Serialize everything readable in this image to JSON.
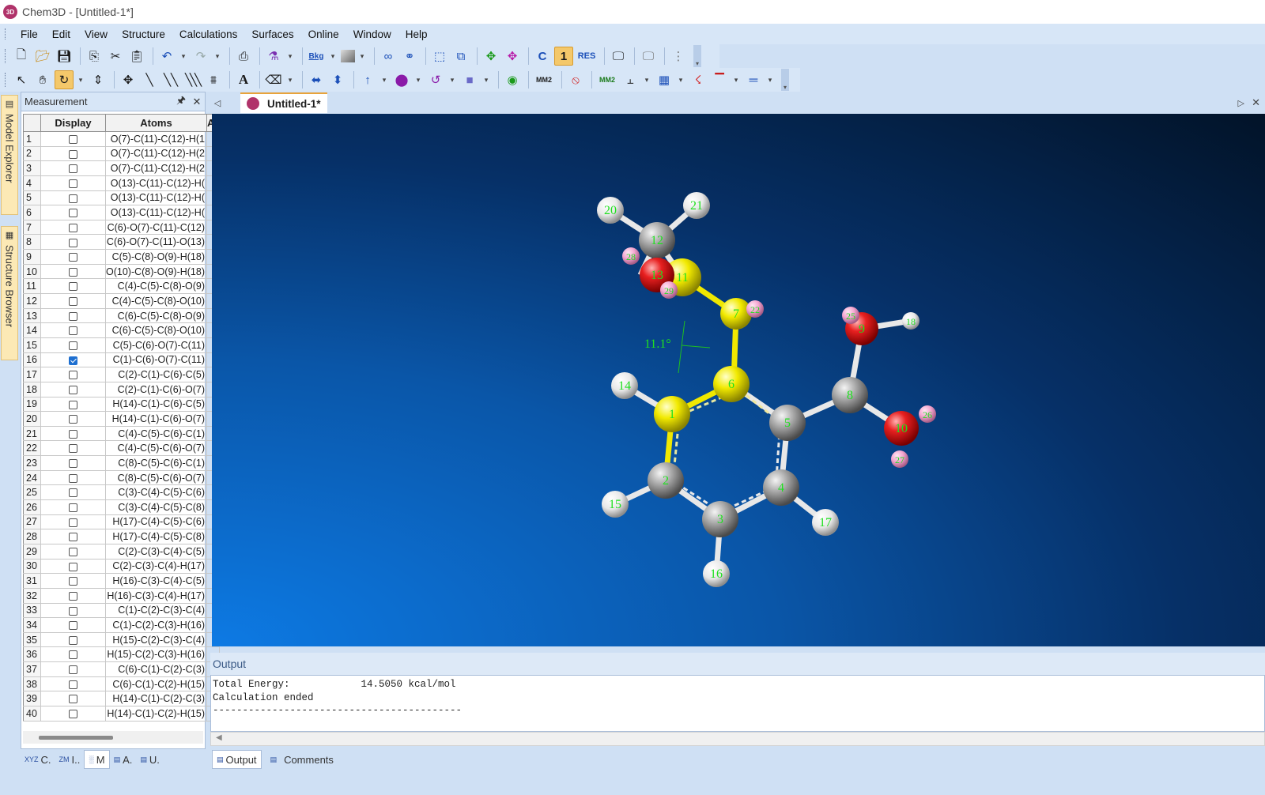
{
  "app": {
    "title": "Chem3D - [Untitled-1*]",
    "icon_label": "3D"
  },
  "menu": [
    "File",
    "Edit",
    "View",
    "Structure",
    "Calculations",
    "Surfaces",
    "Online",
    "Window",
    "Help"
  ],
  "toolbar1": {
    "bkg_label": "Bkg",
    "c_label": "C",
    "one_label": "1",
    "res_label": "RES"
  },
  "toolbar2": {
    "text_tool_label": "A",
    "mm2_label": "MM2",
    "mm2_run_label": "MM2"
  },
  "side_tabs": {
    "model_explorer": "Model Explorer",
    "structure_browser": "Structure Browser"
  },
  "measurement": {
    "title": "Measurement",
    "columns": [
      "",
      "Display",
      "Atoms",
      "Ac"
    ],
    "rows": [
      {
        "n": "1",
        "checked": false,
        "atoms": "O(7)-C(11)-C(12)-H(1"
      },
      {
        "n": "2",
        "checked": false,
        "atoms": "O(7)-C(11)-C(12)-H(2"
      },
      {
        "n": "3",
        "checked": false,
        "atoms": "O(7)-C(11)-C(12)-H(2"
      },
      {
        "n": "4",
        "checked": false,
        "atoms": "O(13)-C(11)-C(12)-H("
      },
      {
        "n": "5",
        "checked": false,
        "atoms": "O(13)-C(11)-C(12)-H("
      },
      {
        "n": "6",
        "checked": false,
        "atoms": "O(13)-C(11)-C(12)-H("
      },
      {
        "n": "7",
        "checked": false,
        "atoms": "C(6)-O(7)-C(11)-C(12)"
      },
      {
        "n": "8",
        "checked": false,
        "atoms": "C(6)-O(7)-C(11)-O(13)"
      },
      {
        "n": "9",
        "checked": false,
        "atoms": "C(5)-C(8)-O(9)-H(18)"
      },
      {
        "n": "10",
        "checked": false,
        "atoms": "O(10)-C(8)-O(9)-H(18)"
      },
      {
        "n": "11",
        "checked": false,
        "atoms": "C(4)-C(5)-C(8)-O(9)"
      },
      {
        "n": "12",
        "checked": false,
        "atoms": "C(4)-C(5)-C(8)-O(10)"
      },
      {
        "n": "13",
        "checked": false,
        "atoms": "C(6)-C(5)-C(8)-O(9)"
      },
      {
        "n": "14",
        "checked": false,
        "atoms": "C(6)-C(5)-C(8)-O(10)"
      },
      {
        "n": "15",
        "checked": false,
        "atoms": "C(5)-C(6)-O(7)-C(11)"
      },
      {
        "n": "16",
        "checked": true,
        "atoms": "C(1)-C(6)-O(7)-C(11)"
      },
      {
        "n": "17",
        "checked": false,
        "atoms": "C(2)-C(1)-C(6)-C(5)"
      },
      {
        "n": "18",
        "checked": false,
        "atoms": "C(2)-C(1)-C(6)-O(7)"
      },
      {
        "n": "19",
        "checked": false,
        "atoms": "H(14)-C(1)-C(6)-C(5)"
      },
      {
        "n": "20",
        "checked": false,
        "atoms": "H(14)-C(1)-C(6)-O(7)"
      },
      {
        "n": "21",
        "checked": false,
        "atoms": "C(4)-C(5)-C(6)-C(1)"
      },
      {
        "n": "22",
        "checked": false,
        "atoms": "C(4)-C(5)-C(6)-O(7)"
      },
      {
        "n": "23",
        "checked": false,
        "atoms": "C(8)-C(5)-C(6)-C(1)"
      },
      {
        "n": "24",
        "checked": false,
        "atoms": "C(8)-C(5)-C(6)-O(7)"
      },
      {
        "n": "25",
        "checked": false,
        "atoms": "C(3)-C(4)-C(5)-C(6)"
      },
      {
        "n": "26",
        "checked": false,
        "atoms": "C(3)-C(4)-C(5)-C(8)"
      },
      {
        "n": "27",
        "checked": false,
        "atoms": "H(17)-C(4)-C(5)-C(6)"
      },
      {
        "n": "28",
        "checked": false,
        "atoms": "H(17)-C(4)-C(5)-C(8)"
      },
      {
        "n": "29",
        "checked": false,
        "atoms": "C(2)-C(3)-C(4)-C(5)"
      },
      {
        "n": "30",
        "checked": false,
        "atoms": "C(2)-C(3)-C(4)-H(17)"
      },
      {
        "n": "31",
        "checked": false,
        "atoms": "H(16)-C(3)-C(4)-C(5)"
      },
      {
        "n": "32",
        "checked": false,
        "atoms": "H(16)-C(3)-C(4)-H(17)"
      },
      {
        "n": "33",
        "checked": false,
        "atoms": "C(1)-C(2)-C(3)-C(4)"
      },
      {
        "n": "34",
        "checked": false,
        "atoms": "C(1)-C(2)-C(3)-H(16)"
      },
      {
        "n": "35",
        "checked": false,
        "atoms": "H(15)-C(2)-C(3)-C(4)"
      },
      {
        "n": "36",
        "checked": false,
        "atoms": "H(15)-C(2)-C(3)-H(16)"
      },
      {
        "n": "37",
        "checked": false,
        "atoms": "C(6)-C(1)-C(2)-C(3)"
      },
      {
        "n": "38",
        "checked": false,
        "atoms": "C(6)-C(1)-C(2)-H(15)"
      },
      {
        "n": "39",
        "checked": false,
        "atoms": "H(14)-C(1)-C(2)-C(3)"
      },
      {
        "n": "40",
        "checked": false,
        "atoms": "H(14)-C(1)-C(2)-H(15)"
      }
    ]
  },
  "left_bottom_tabs": [
    {
      "icon": "XYZ",
      "label": "C."
    },
    {
      "icon": "ZM",
      "label": "I.."
    },
    {
      "icon": "░",
      "label": "M"
    },
    {
      "icon": "▤",
      "label": "A."
    },
    {
      "icon": "▤",
      "label": "U."
    }
  ],
  "document": {
    "tab_label": "Untitled-1*"
  },
  "molecule": {
    "angle_label": "11.1°",
    "colors": {
      "carbon": "#9a9a9a",
      "oxygen": "#e01818",
      "hydrogen": "#f2f2f2",
      "selected": "#f0e800",
      "lone_pair": "#f4a6d0",
      "label": "#1fe01f"
    },
    "atom_labels": [
      "1",
      "2",
      "3",
      "4",
      "5",
      "6",
      "7",
      "8",
      "9",
      "10",
      "11",
      "12",
      "13",
      "14",
      "15",
      "16",
      "17",
      "18",
      "20",
      "21",
      "22",
      "25",
      "26",
      "27",
      "28",
      "29"
    ]
  },
  "output": {
    "title": "Output",
    "lines": [
      "Total Energy:            14.5050 kcal/mol",
      "Calculation ended",
      "------------------------------------------"
    ]
  },
  "right_bottom_tabs": [
    {
      "label": "Output",
      "selected": true
    },
    {
      "label": "Comments",
      "selected": false
    }
  ]
}
